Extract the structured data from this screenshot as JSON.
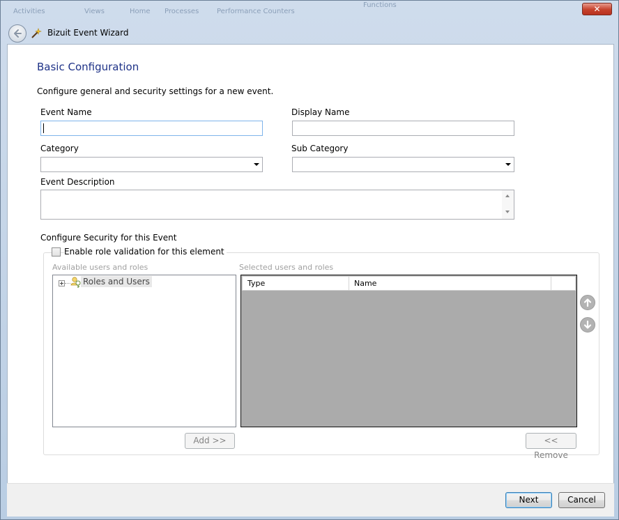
{
  "window": {
    "title": "Bizuit Event Wizard",
    "background_text": [
      "Activities",
      "Views",
      "Home",
      "Processes",
      "Performance Counters",
      "Functions"
    ],
    "close_glyph": "✕"
  },
  "page": {
    "heading": "Basic Configuration",
    "description": "Configure general and security settings for a new event."
  },
  "form": {
    "event_name": {
      "label": "Event Name",
      "value": ""
    },
    "display_name": {
      "label": "Display Name",
      "value": ""
    },
    "category": {
      "label": "Category",
      "value": ""
    },
    "sub_category": {
      "label": "Sub Category",
      "value": ""
    },
    "event_description": {
      "label": "Event Description",
      "value": ""
    }
  },
  "security": {
    "section_label": "Configure Security for this Event",
    "checkbox_label": "Enable role validation for this element",
    "checkbox_checked": false,
    "available_label": "Available users and roles",
    "selected_label": "Selected users and roles",
    "tree": [
      {
        "label": "Roles and Users",
        "icon": "roles-users-icon",
        "expanded": false
      }
    ],
    "grid_columns": [
      "Type",
      "Name"
    ],
    "grid_rows": [],
    "add_button": "Add >>",
    "remove_button": "<< Remove",
    "move_up_icon": "arrow-up-icon",
    "move_down_icon": "arrow-down-icon"
  },
  "footer": {
    "next_button": "Next",
    "cancel_button": "Cancel"
  },
  "colors": {
    "heading": "#1e3287",
    "grid_background": "#ababab",
    "close_button": "#c6412c"
  }
}
